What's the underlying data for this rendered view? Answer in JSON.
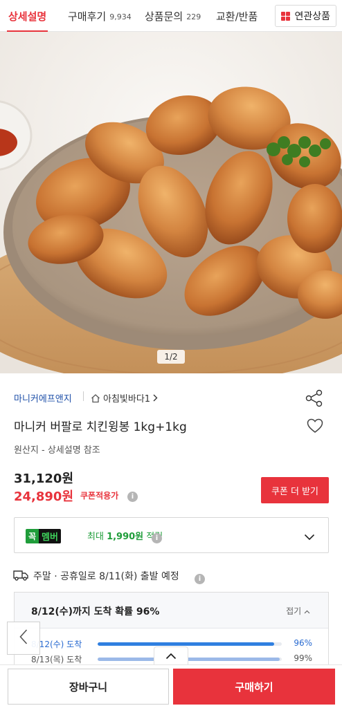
{
  "tabs": [
    {
      "label": "상세설명",
      "count": ""
    },
    {
      "label": "구매후기",
      "count": "9,934"
    },
    {
      "label": "상품문의",
      "count": "229"
    },
    {
      "label": "교환/반품",
      "count": ""
    }
  ],
  "related_label": "연관상품",
  "image": {
    "counter": "1/2",
    "alt_icon": "chicken-wings-photo"
  },
  "seller": {
    "name": "마니커에프앤지",
    "store": "아침빛바다1"
  },
  "product": {
    "title": "마니커 버팔로 치킨윙봉 1kg+1kg",
    "origin": "원산지 - 상세설명 참조",
    "price_original": "31,120원",
    "price_sale": "24,890원",
    "coupon_label": "쿠폰적용가",
    "coupon_button": "쿠폰 더 받기"
  },
  "membership": {
    "badge_k": "꼭",
    "badge_m": "멤버",
    "text_prefix": "최대 ",
    "amount": "1,990원",
    "text_suffix": " 적립"
  },
  "shipping": {
    "text": "주말 · 공휴일로 8/11(화) 출발 예정",
    "box_title": "8/12(수)까지 도착 확률 96%",
    "collapse_label": "접기",
    "rows": [
      {
        "date": "8/12(수) 도착",
        "percent": 96,
        "label": "96%"
      },
      {
        "date": "8/13(목) 도착",
        "percent": 99,
        "label": "99%"
      }
    ]
  },
  "bottom": {
    "cart": "장바구니",
    "buy": "구매하기"
  },
  "colors": {
    "accent": "#e8333c",
    "seller_link": "#1e4fa8",
    "member_green": "#1f9d3a",
    "prob_blue": "#2f7fe0"
  }
}
